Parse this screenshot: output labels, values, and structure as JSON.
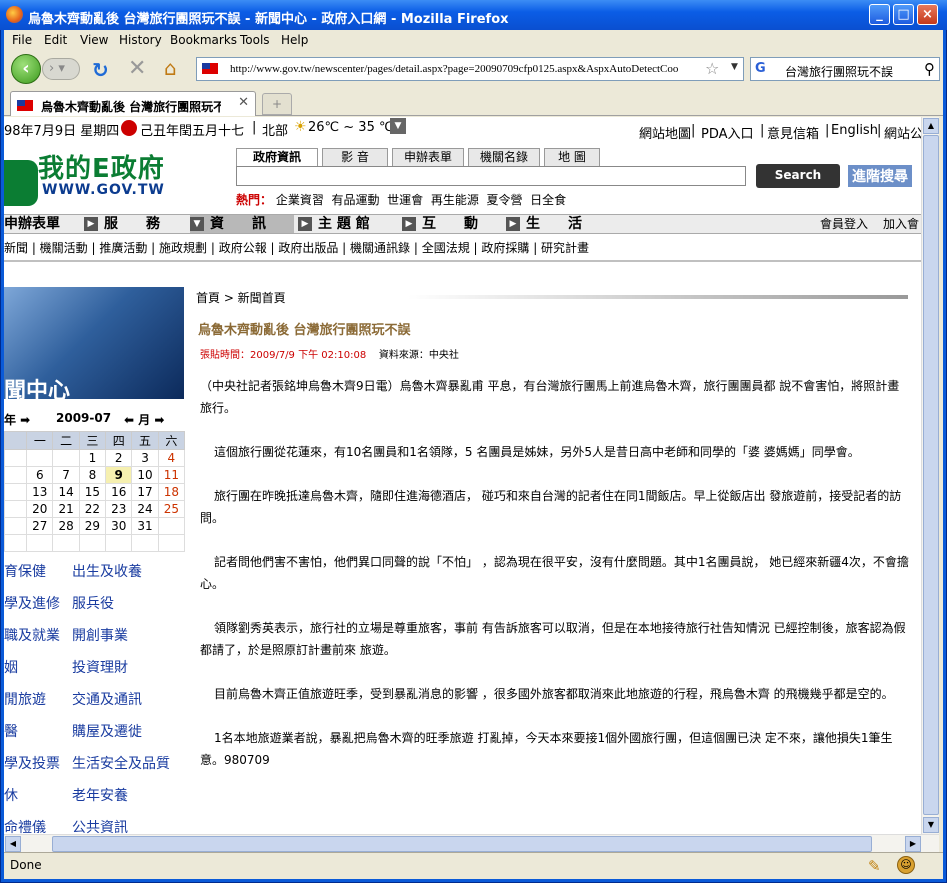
{
  "window": {
    "title": "烏魯木齊動亂後 台灣旅行團照玩不誤 - 新聞中心 - 政府入口網 - Mozilla Firefox",
    "minimize": "_",
    "maximize": "□",
    "close": "×"
  },
  "menu": [
    "File",
    "Edit",
    "View",
    "History",
    "Bookmarks",
    "Tools",
    "Help"
  ],
  "nav": {
    "url": "http://www.gov.tw/newscenter/pages/detail.aspx?page=20090709cfp0125.aspx&AspxAutoDetectCoo",
    "search_value": "台灣旅行團照玩不誤"
  },
  "tabs": [
    {
      "label": "烏魯木齊動亂後 台灣旅行團照玩不…"
    }
  ],
  "page": {
    "date_line": "98年7月9日 星期四",
    "lunar": "己丑年閏五月十七",
    "location": "北部",
    "weather": "26℃ ~ 35 ℃",
    "top_links": [
      "網站地圖",
      "PDA入口",
      "意見信箱",
      "English",
      "網站公"
    ],
    "logo_title": "我的E政府",
    "logo_url": "WWW.GOV.TW",
    "search_tabs": [
      "政府資訊",
      "影 音",
      "申辦表單",
      "機關名錄",
      "地 圖"
    ],
    "search_button": "Search",
    "advanced_search": "進階搜尋",
    "hot_label": "熱門：",
    "hot_items": [
      "企業資習",
      "有品運動",
      "世運會",
      "再生能源",
      "夏令營",
      "日全食"
    ],
    "main_nav": [
      "申辦表單",
      "服　　務",
      "資　　訊",
      "主 題 館",
      "互　　動",
      "生　　活"
    ],
    "member_login": "會員登入",
    "join": "加入會",
    "sub_nav": "新聞 | 機關活動 | 推廣活動 | 施政規劃 | 政府公報 | 政府出版品 | 機關通訊錄 | 全國法規 | 政府採購 | 研究計畫",
    "left_image_label": "聞中心",
    "calendar": {
      "prev_year": "年 ➡",
      "month": "2009-07",
      "prev_month": "⬅ 月 ➡",
      "weekdays": [
        "一",
        "二",
        "三",
        "四",
        "五",
        "六"
      ],
      "rows": [
        [
          "",
          "",
          "",
          "1",
          "2",
          "3",
          "4"
        ],
        [
          "",
          "6",
          "7",
          "8",
          "9",
          "10",
          "11"
        ],
        [
          "",
          "13",
          "14",
          "15",
          "16",
          "17",
          "18"
        ],
        [
          "",
          "20",
          "21",
          "22",
          "23",
          "24",
          "25"
        ],
        [
          "",
          "27",
          "28",
          "29",
          "30",
          "31",
          ""
        ],
        [
          "",
          "",
          "",
          "",
          "",
          "",
          ""
        ]
      ]
    },
    "left_links": [
      [
        "育保健",
        "出生及收養"
      ],
      [
        "學及進修",
        "服兵役"
      ],
      [
        "職及就業",
        "開創事業"
      ],
      [
        "姻",
        "投資理財"
      ],
      [
        "閒旅遊",
        "交通及通訊"
      ],
      [
        "醫",
        "購屋及遷徙"
      ],
      [
        "學及投票",
        "生活安全及品質"
      ],
      [
        "休",
        "老年安養"
      ],
      [
        "命禮儀",
        "公共資訊"
      ]
    ],
    "breadcrumb": "首頁 > 新聞首頁",
    "article": {
      "title": "烏魯木齊動亂後 台灣旅行團照玩不誤",
      "time_label": "張貼時間：2009/7/9 下午 02:10:08",
      "source": "資料來源：中央社",
      "paragraphs": [
        "（中央社記者張銘坤烏魯木齊9日電）烏魯木齊暴亂甫 平息，有台灣旅行團馬上前進烏魯木齊，旅行團團員都 說不會害怕，將照計畫旅行。",
        "這個旅行團從花蓮來，有10名團員和1名領隊，5 名團員是姊妹，另外5人是昔日高中老師和同學的「婆 婆媽媽」同學會。",
        "旅行團在昨晚抵達烏魯木齊，隨即住進海德酒店， 碰巧和來自台灣的記者住在同1間飯店。早上從飯店出 發旅遊前，接受記者的訪問。",
        "記者問他們害不害怕，他們異口同聲的說「不怕」 ，認為現在很平安，沒有什麼問題。其中1名團員說， 她已經來新疆4次，不會擔心。",
        "領隊劉秀英表示，旅行社的立場是尊重旅客，事前 有告訴旅客可以取消，但是在本地接待旅行社告知情況 已經控制後，旅客認為假都請了，於是照原訂計畫前來 旅遊。",
        "目前烏魯木齊正值旅遊旺季，受到暴亂消息的影響 ，很多國外旅客都取消來此地旅遊的行程，飛烏魯木齊 的飛機幾乎都是空的。",
        "1名本地旅遊業者說，暴亂把烏魯木齊的旺季旅遊 打亂掉，今天本來要接1個外國旅行團，但這個團已決 定不來，讓他損失1筆生意。980709"
      ]
    }
  },
  "status": "Done"
}
